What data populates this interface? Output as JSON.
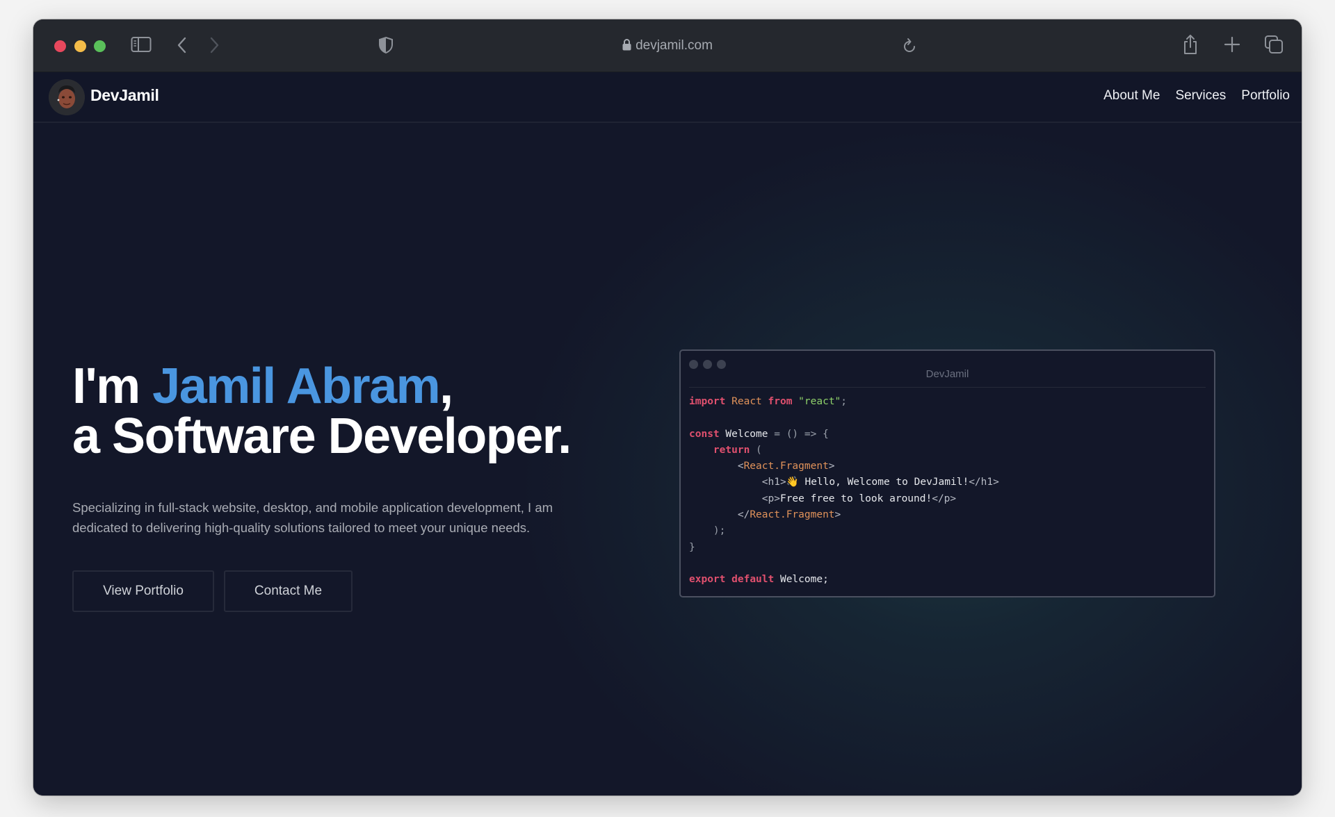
{
  "browser": {
    "url": "devjamil.com",
    "icons": {
      "sidebar": "sidebar-icon",
      "back": "chevron-left-icon",
      "forward": "chevron-right-icon",
      "privacy": "shield-icon",
      "lock": "lock-icon",
      "reload": "reload-icon",
      "share": "share-icon",
      "new_tab": "plus-icon",
      "tabs": "tabs-overview-icon"
    }
  },
  "site": {
    "brand": "DevJamil",
    "nav": [
      {
        "label": "About Me"
      },
      {
        "label": "Services"
      },
      {
        "label": "Portfolio"
      }
    ]
  },
  "hero": {
    "title_prefix": "I'm ",
    "title_name": "Jamil Abram",
    "title_comma": ",",
    "title_line2": "a Software Developer.",
    "description": "Specializing in full-stack website, desktop, and mobile application development, I am dedicated to delivering high-quality solutions tailored to meet your unique needs.",
    "buttons": {
      "portfolio": "View Portfolio",
      "contact": "Contact Me"
    },
    "colors": {
      "accent": "#4a96e0",
      "background": "#131729"
    }
  },
  "code_window": {
    "title": "DevJamil",
    "lines": [
      [
        {
          "t": "import",
          "c": "kw"
        },
        {
          "t": " "
        },
        {
          "t": "React",
          "c": "cls"
        },
        {
          "t": " "
        },
        {
          "t": "from",
          "c": "kw"
        },
        {
          "t": " "
        },
        {
          "t": "\"react\"",
          "c": "str"
        },
        {
          "t": ";",
          "c": "pun"
        }
      ],
      [],
      [
        {
          "t": "const",
          "c": "kw"
        },
        {
          "t": " Welcome "
        },
        {
          "t": "= () => {",
          "c": "pun"
        }
      ],
      [
        {
          "t": "    "
        },
        {
          "t": "return",
          "c": "kw"
        },
        {
          "t": " (",
          "c": "pun"
        }
      ],
      [
        {
          "t": "        "
        },
        {
          "t": "<",
          "c": "tag"
        },
        {
          "t": "React.Fragment",
          "c": "cls"
        },
        {
          "t": ">",
          "c": "tag"
        }
      ],
      [
        {
          "t": "            "
        },
        {
          "t": "<h1>",
          "c": "tag"
        },
        {
          "t": "👋 Hello, Welcome to DevJamil!"
        },
        {
          "t": "</h1>",
          "c": "tag"
        }
      ],
      [
        {
          "t": "            "
        },
        {
          "t": "<p>",
          "c": "tag"
        },
        {
          "t": "Free free to look around!"
        },
        {
          "t": "</p>",
          "c": "tag"
        }
      ],
      [
        {
          "t": "        "
        },
        {
          "t": "</",
          "c": "tag"
        },
        {
          "t": "React.Fragment",
          "c": "cls"
        },
        {
          "t": ">",
          "c": "tag"
        }
      ],
      [
        {
          "t": "    "
        },
        {
          "t": ");",
          "c": "pun"
        }
      ],
      [
        {
          "t": "}",
          "c": "pun"
        }
      ],
      [],
      [
        {
          "t": "export",
          "c": "kw"
        },
        {
          "t": " "
        },
        {
          "t": "default",
          "c": "kw"
        },
        {
          "t": " Welcome;"
        }
      ]
    ]
  }
}
